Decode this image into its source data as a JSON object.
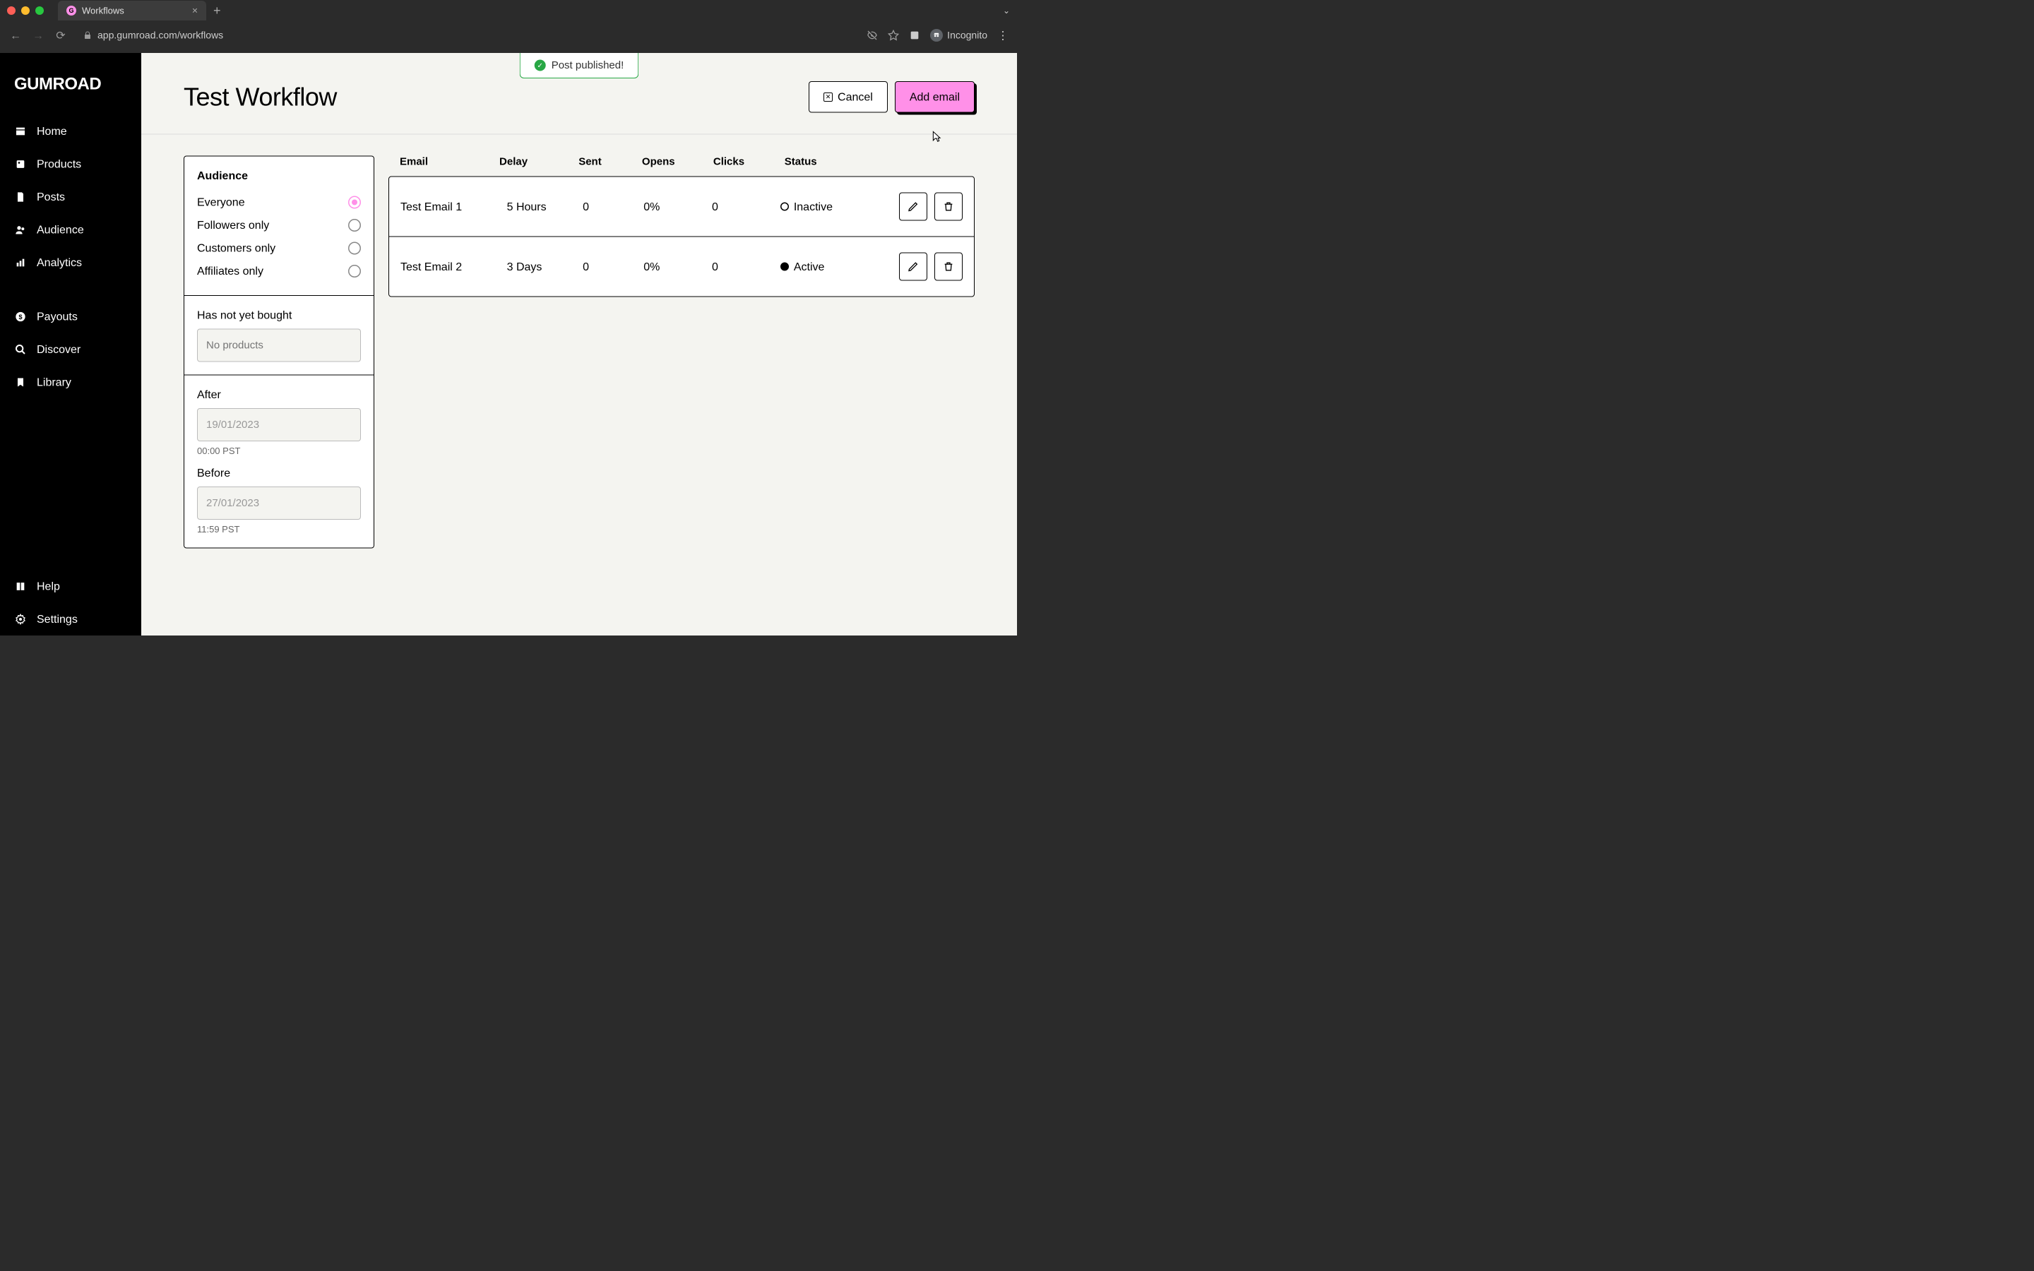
{
  "browser": {
    "tab_title": "Workflows",
    "url": "app.gumroad.com/workflows",
    "incognito_label": "Incognito"
  },
  "sidebar": {
    "logo": "GUMROAD",
    "items": [
      {
        "label": "Home"
      },
      {
        "label": "Products"
      },
      {
        "label": "Posts"
      },
      {
        "label": "Audience"
      },
      {
        "label": "Analytics"
      },
      {
        "label": "Payouts"
      },
      {
        "label": "Discover"
      },
      {
        "label": "Library"
      },
      {
        "label": "Help"
      },
      {
        "label": "Settings"
      }
    ]
  },
  "toast": {
    "message": "Post published!"
  },
  "header": {
    "title": "Test Workflow",
    "cancel_label": "Cancel",
    "add_email_label": "Add email"
  },
  "audience": {
    "title": "Audience",
    "options": [
      {
        "label": "Everyone",
        "selected": true
      },
      {
        "label": "Followers only",
        "selected": false
      },
      {
        "label": "Customers only",
        "selected": false
      },
      {
        "label": "Affiliates only",
        "selected": false
      }
    ],
    "has_not_bought_label": "Has not yet bought",
    "has_not_bought_placeholder": "No products",
    "after_label": "After",
    "after_value": "19/01/2023",
    "after_time": "00:00 PST",
    "before_label": "Before",
    "before_value": "27/01/2023",
    "before_time": "11:59 PST"
  },
  "table": {
    "columns": {
      "email": "Email",
      "delay": "Delay",
      "sent": "Sent",
      "opens": "Opens",
      "clicks": "Clicks",
      "status": "Status"
    },
    "rows": [
      {
        "email": "Test Email 1",
        "delay": "5 Hours",
        "sent": "0",
        "opens": "0%",
        "clicks": "0",
        "status": "Inactive",
        "active": false
      },
      {
        "email": "Test Email 2",
        "delay": "3 Days",
        "sent": "0",
        "opens": "0%",
        "clicks": "0",
        "status": "Active",
        "active": true
      }
    ]
  }
}
